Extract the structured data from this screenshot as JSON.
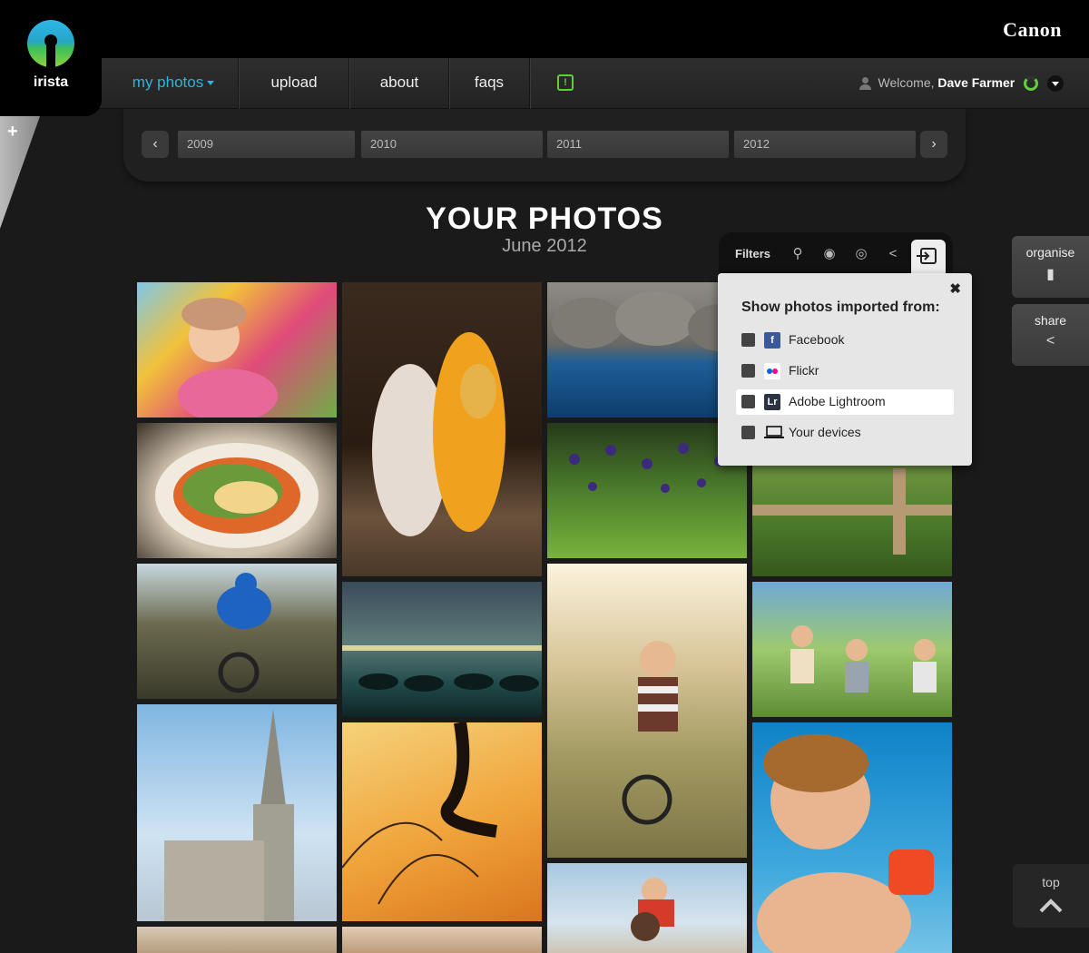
{
  "brand": {
    "camera_brand": "Canon",
    "app_name": "irista"
  },
  "nav": {
    "items": [
      "my photos",
      "upload",
      "about",
      "faqs"
    ],
    "notify_icon": "!",
    "welcome_prefix": "Welcome,",
    "user_name": "Dave Farmer"
  },
  "years": [
    "2009",
    "2010",
    "2011",
    "2012"
  ],
  "header": {
    "title": "YOUR PHOTOS",
    "subtitle": "June 2012"
  },
  "filters": {
    "label": "Filters",
    "tools": [
      "tag-icon",
      "camera-icon",
      "lens-icon",
      "share-icon",
      "import-icon"
    ],
    "popup_title": "Show photos imported from:",
    "options": [
      {
        "label": "Facebook",
        "icon": "facebook-icon",
        "icon_text": "f",
        "color": "#3b5998",
        "checked": false
      },
      {
        "label": "Flickr",
        "icon": "flickr-icon",
        "icon_text": "••",
        "color": "#ffffff",
        "checked": false
      },
      {
        "label": "Adobe Lightroom",
        "icon": "lightroom-icon",
        "icon_text": "Lr",
        "color": "#2b3440",
        "checked": true
      },
      {
        "label": "Your devices",
        "icon": "laptop-icon",
        "icon_text": "",
        "color": "#000000",
        "checked": false
      }
    ]
  },
  "side": {
    "organise": "organise",
    "share": "share",
    "top": "top"
  },
  "colors": {
    "accent": "#2fb4d8",
    "green": "#5fcf3a",
    "background": "#1a1a1a"
  }
}
